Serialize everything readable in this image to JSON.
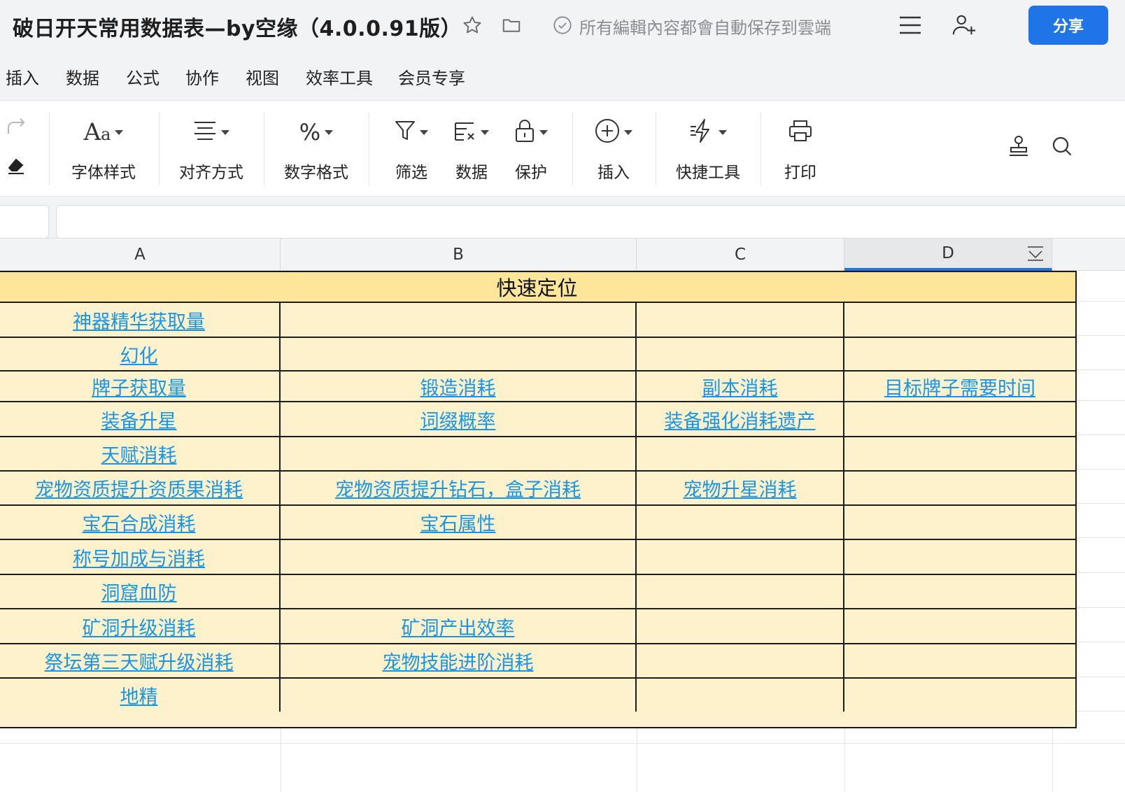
{
  "window": {
    "title": "破日开天常用数据表—by空缘（4.0.0.91版）",
    "save_status": "所有編輯內容都會自動保存到雲端",
    "share_label": "分享",
    "accent_color": "#1f75e8",
    "icons": [
      "star-icon",
      "folder-icon",
      "check-circle-icon",
      "menu-icon",
      "add-user-icon"
    ]
  },
  "menu": {
    "items": [
      "插入",
      "数据",
      "公式",
      "协作",
      "视图",
      "效率工具",
      "会员专享"
    ]
  },
  "toolbar": {
    "tools": [
      {
        "label": "字体样式",
        "icon": "font-icon"
      },
      {
        "label": "对齐方式",
        "icon": "align-icon"
      },
      {
        "label": "数字格式",
        "icon": "percent-icon"
      },
      {
        "label": "筛选",
        "icon": "filter-icon"
      },
      {
        "label": "数据",
        "icon": "data-icon"
      },
      {
        "label": "保护",
        "icon": "lock-icon"
      },
      {
        "label": "插入",
        "icon": "plus-circle-icon"
      },
      {
        "label": "快捷工具",
        "icon": "quick-tools-icon"
      },
      {
        "label": "打印",
        "icon": "printer-icon"
      }
    ],
    "left_icons": [
      "redo-icon",
      "eraser-icon"
    ],
    "right_icons": [
      "stamp-icon",
      "search-icon"
    ]
  },
  "columns": [
    "A",
    "B",
    "C",
    "D"
  ],
  "sheet": {
    "header": "快速定位",
    "header_fill": "#fde59a",
    "cell_fill": "#fef2cc",
    "link_color": "#1a95e6",
    "rows": [
      [
        "神器精华获取量",
        "",
        "",
        ""
      ],
      [
        "幻化",
        "",
        "",
        ""
      ],
      [
        "牌子获取量",
        "锻造消耗",
        "副本消耗",
        "目标牌子需要时间"
      ],
      [
        "装备升星",
        "词缀概率",
        "装备强化消耗遗产",
        ""
      ],
      [
        "天赋消耗",
        "",
        "",
        ""
      ],
      [
        "宠物资质提升资质果消耗",
        "宠物资质提升钻石，盒子消耗",
        "宠物升星消耗",
        ""
      ],
      [
        "宝石合成消耗",
        "宝石属性",
        "",
        ""
      ],
      [
        "称号加成与消耗",
        "",
        "",
        ""
      ],
      [
        "洞窟血防",
        "",
        "",
        ""
      ],
      [
        "矿洞升级消耗",
        "矿洞产出效率",
        "",
        ""
      ],
      [
        "祭坛第三天赋升级消耗",
        "宠物技能进阶消耗",
        "",
        ""
      ],
      [
        "地精",
        "",
        "",
        ""
      ]
    ]
  }
}
